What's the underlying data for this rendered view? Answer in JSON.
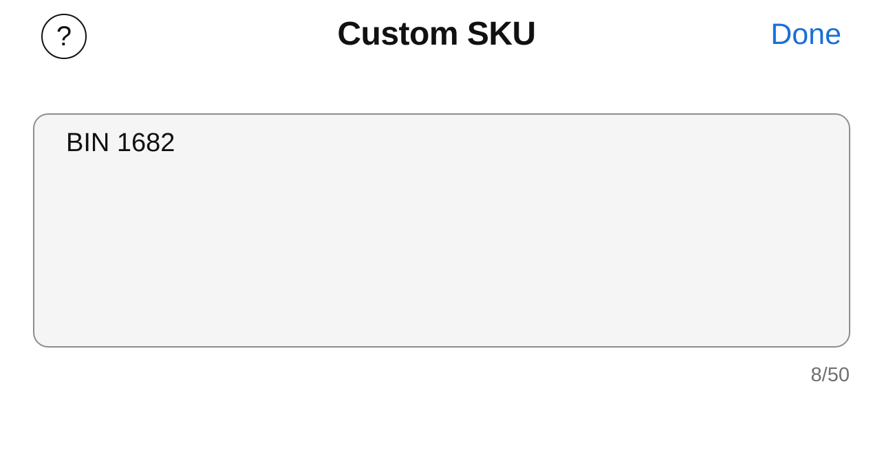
{
  "header": {
    "help_glyph": "?",
    "title": "Custom SKU",
    "done_label": "Done",
    "accent_color": "#1a6fd9"
  },
  "sku_input": {
    "value": "BIN 1682",
    "char_count": "8/50"
  }
}
